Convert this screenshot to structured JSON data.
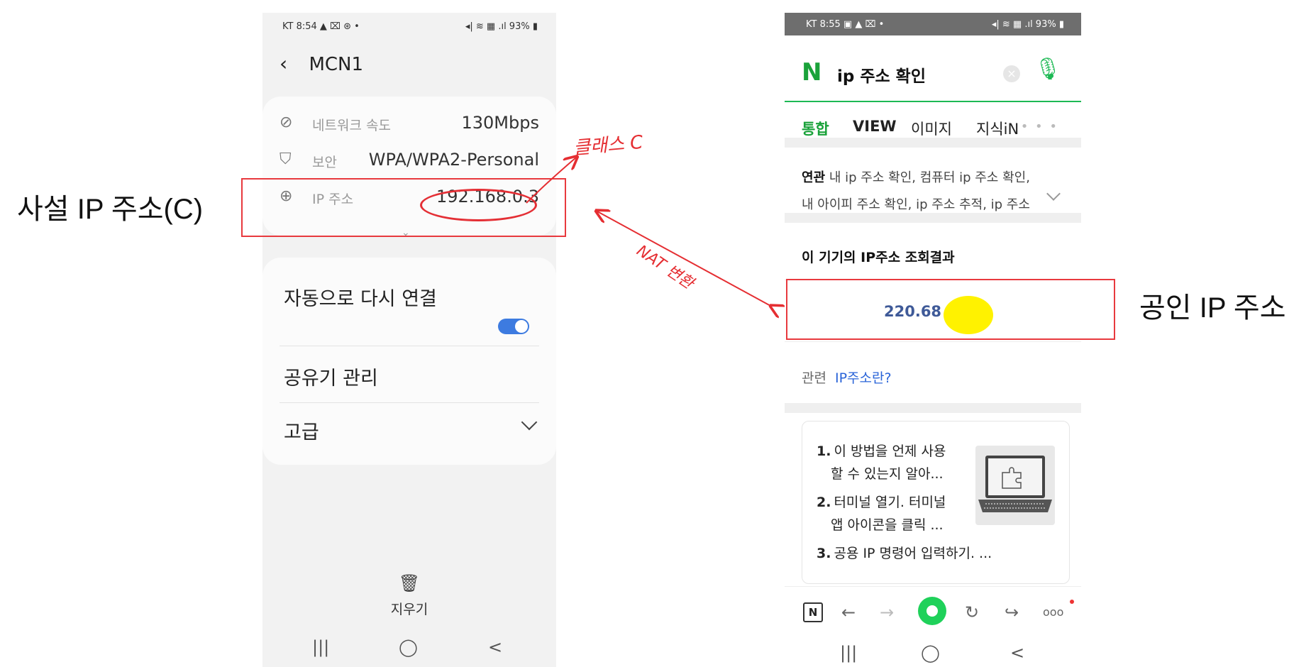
{
  "annotations": {
    "private_ip_label": "사설 IP 주소(C)",
    "public_ip_label": "공인 IP 주소",
    "class_c_label": "클래스 C",
    "nat_label": "NAT 변환",
    "annotation_color": "#e52e32",
    "highlight_color": "#fff200"
  },
  "left_phone": {
    "status_bar": {
      "time": "KT 8:54 ▲ ⌧ ⊛ •",
      "right": "◂| ≋ ▦ .ıl 93% ▮"
    },
    "header": {
      "title": "MCN1"
    },
    "network_info": [
      {
        "icon": "speed-icon",
        "label": "네트워크 속도",
        "value": "130Mbps"
      },
      {
        "icon": "shield-icon",
        "label": "보안",
        "value": "WPA/WPA2-Personal"
      },
      {
        "icon": "globe-icon",
        "label": "IP 주소",
        "value": "192.168.0.3"
      }
    ],
    "options": {
      "auto_reconnect": "자동으로 다시 연결",
      "auto_reconnect_on": true,
      "router_manage": "공유기 관리",
      "advanced": "고급"
    },
    "delete_label": "지우기",
    "nav": [
      "|||",
      "◯",
      "<"
    ]
  },
  "right_phone": {
    "status_bar": {
      "time": "KT 8:55 ▣ ▲ ⌧ •",
      "right": "◂| ≋ ▦ .ıl 93% ▮"
    },
    "logo": "N",
    "query": "ip 주소 확인",
    "tabs": [
      "통합",
      "VIEW",
      "이미지",
      "지식iN"
    ],
    "more": "• • •",
    "related_head": "연관",
    "related_line1": "내 ip 주소 확인, 컴퓨터 ip 주소 확인,",
    "related_line2": "내 아이피 주소 확인, ip 주소 추적, ip 주소",
    "result_title": "이 기기의 IP주소 조회결과",
    "ip_partial": "220.68",
    "rel_label": "관련",
    "rel_link": "IP주소란?",
    "steps": [
      {
        "num": "1.",
        "line1": "이 방법을 언제 사용",
        "line2": "할 수 있는지 알아..."
      },
      {
        "num": "2.",
        "line1": "터미널 열기. 터미널",
        "line2": "앱 아이콘을 클릭 ..."
      },
      {
        "num": "3.",
        "line1": "공용 IP 명령어 입력하기. ...",
        "line2": ""
      }
    ],
    "toolbar": {
      "n": "N",
      "back": "←",
      "forward": "→",
      "refresh": "↻",
      "share": "↪",
      "more": "ooo"
    },
    "nav": [
      "|||",
      "◯",
      "<"
    ]
  }
}
